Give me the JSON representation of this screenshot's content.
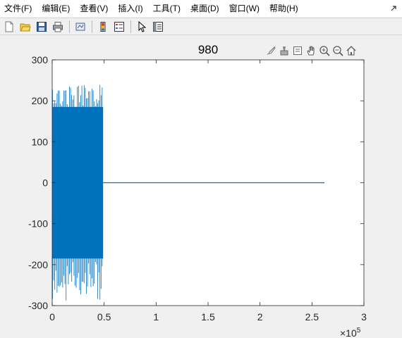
{
  "menu": {
    "items": [
      "文件(F)",
      "编辑(E)",
      "查看(V)",
      "插入(I)",
      "工具(T)",
      "桌面(D)",
      "窗口(W)",
      "帮助(H)"
    ]
  },
  "toolbar": {
    "buttons": [
      "new-figure-icon",
      "open-file-icon",
      "save-icon",
      "print-icon",
      "link-plot-icon",
      "colorbar-icon",
      "legend-icon",
      "pointer-icon",
      "property-inspector-icon"
    ]
  },
  "axes_toolbar": {
    "buttons": [
      "brush-icon",
      "data-tips-icon",
      "export-icon",
      "pan-hand-icon",
      "zoom-in-icon",
      "zoom-out-icon",
      "home-icon"
    ]
  },
  "colors": {
    "line": "#0072BD",
    "axes_bg": "#ffffff",
    "axis": "#262626",
    "grid": "#e6e6e6",
    "figure_bg": "#f0f0f0"
  },
  "chart_data": {
    "type": "line",
    "title": "980",
    "xlabel": "",
    "ylabel": "",
    "xlim": [
      0,
      300000
    ],
    "ylim": [
      -300,
      300
    ],
    "x_ticks": [
      0,
      50000,
      100000,
      150000,
      200000,
      250000,
      300000
    ],
    "x_tick_labels": [
      "0",
      "0.5",
      "1",
      "1.5",
      "2",
      "2.5",
      "3"
    ],
    "x_exponent_label": "×10",
    "x_exponent_power": "5",
    "y_ticks": [
      -300,
      -200,
      -100,
      0,
      100,
      200,
      300
    ],
    "y_tick_labels": [
      "-300",
      "-200",
      "-100",
      "0",
      "100",
      "200",
      "300"
    ],
    "series": [
      {
        "signal_segment": {
          "x_start": 0,
          "x_end": 49000,
          "dense_envelope": [
            -185,
            185
          ],
          "max_peak": 240,
          "min_peak": -290
        },
        "flat_segment": {
          "x_start": 49000,
          "x_end": 262000,
          "value": 0
        }
      }
    ]
  }
}
